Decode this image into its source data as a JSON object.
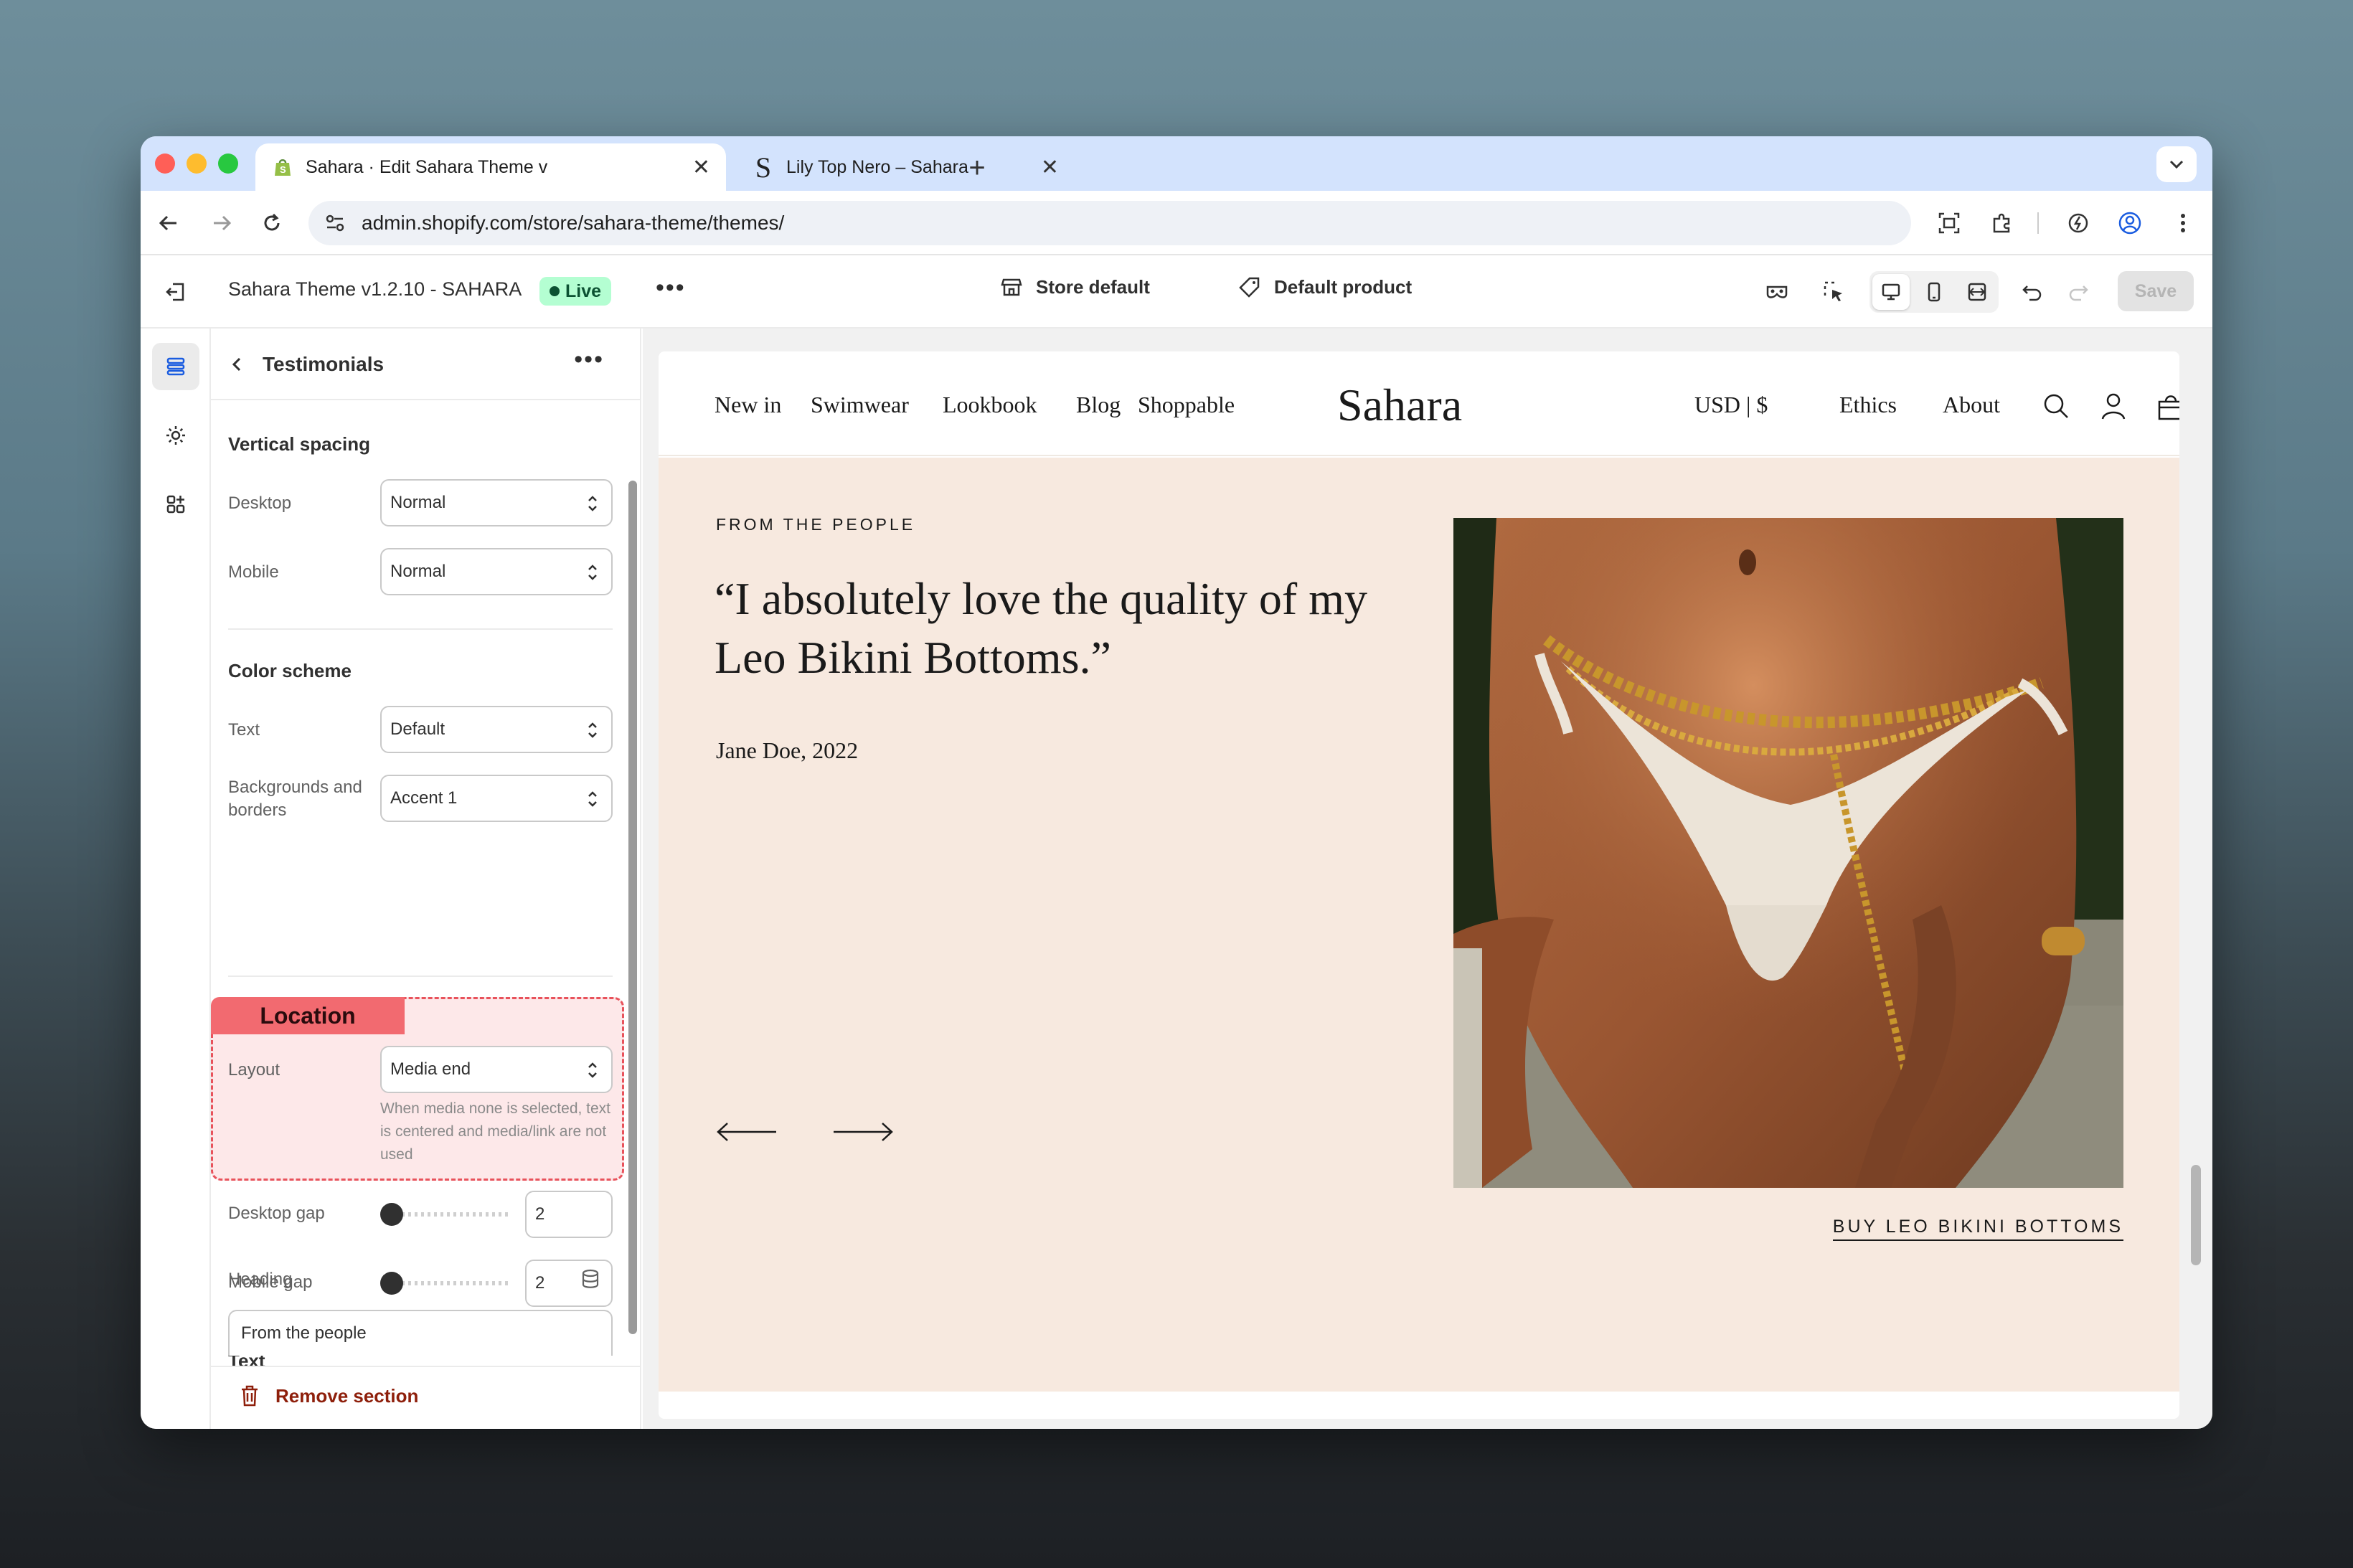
{
  "browser": {
    "tabs": [
      {
        "title": "Sahara · Edit Sahara Theme v",
        "active": true
      },
      {
        "title": "Lily Top Nero – Sahara",
        "active": false
      }
    ],
    "url": "admin.shopify.com/store/sahara-theme/themes/",
    "colors": {
      "close": "#ff5f57",
      "minimize": "#febc2e",
      "zoom": "#28c840",
      "tabstrip": "#d3e3fd"
    }
  },
  "header": {
    "theme_name": "Sahara Theme v1.2.10 - SAHARA",
    "status_badge": "Live",
    "more": "•••",
    "store_select": "Store default",
    "product_select": "Default product",
    "save_label": "Save"
  },
  "panel": {
    "title": "Testimonials",
    "more": "•••",
    "sections": {
      "vertical_spacing": {
        "title": "Vertical spacing",
        "desktop_label": "Desktop",
        "desktop_value": "Normal",
        "mobile_label": "Mobile",
        "mobile_value": "Normal"
      },
      "color_scheme": {
        "title": "Color scheme",
        "text_label": "Text",
        "text_value": "Default",
        "bg_label": "Backgrounds and borders",
        "bg_value": "Accent 1"
      },
      "location": {
        "tag": "Location",
        "layout_label": "Layout",
        "layout_value": "Media end",
        "help": "When media none is selected, text is centered and media/link are not used"
      },
      "gaps": {
        "desktop_label": "Desktop gap",
        "desktop_value": "2",
        "mobile_label": "Mobile gap",
        "mobile_value": "2"
      },
      "text": {
        "title": "Text",
        "heading_label": "Heading",
        "heading_value": "From the people"
      }
    },
    "remove_label": "Remove section",
    "colors": {
      "highlight_fill": "#fde8e9",
      "highlight_border": "#e8525b",
      "tag": "#f26a70",
      "remove": "#8e1f0b"
    }
  },
  "storefront": {
    "nav_left": [
      "New in",
      "Swimwear",
      "Lookbook",
      "Blog",
      "Shoppable"
    ],
    "logo": "Sahara",
    "currency": "USD | $",
    "nav_right": [
      "Ethics",
      "About"
    ],
    "eyebrow": "FROM THE PEOPLE",
    "quote": "“I absolutely love the quality of my Leo Bikini Bottoms.”",
    "author": "Jane Doe, 2022",
    "cta": "BUY LEO BIKINI BOTTOMS",
    "colors": {
      "section_bg": "#f7e9df"
    }
  }
}
